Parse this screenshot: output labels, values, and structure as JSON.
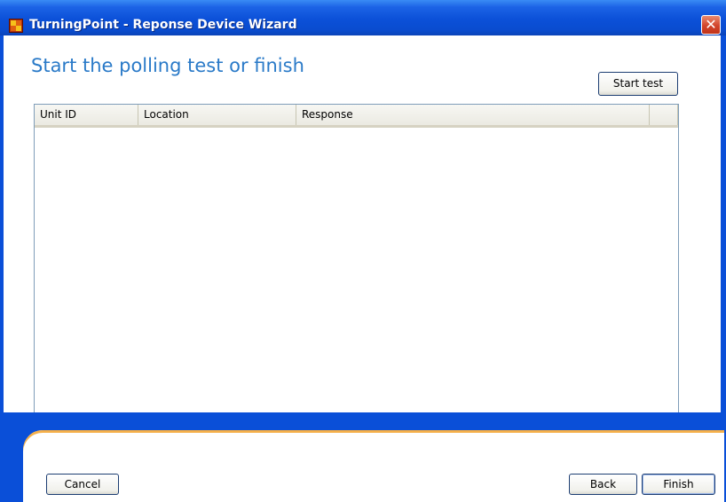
{
  "window": {
    "title": "TurningPoint - Reponse Device Wizard",
    "close_glyph": "✕"
  },
  "page": {
    "heading": "Start the polling test or finish"
  },
  "toolbar": {
    "start_test_label": "Start test"
  },
  "table": {
    "columns": [
      "Unit ID",
      "Location",
      "Response",
      ""
    ],
    "rows": []
  },
  "footer": {
    "cancel_label": "Cancel",
    "back_label": "Back",
    "finish_label": "Finish"
  },
  "colors": {
    "title_bar": "#0a4fd8",
    "heading": "#2a7ac8",
    "accent_orange": "#f5b04a",
    "close": "#d2452c"
  },
  "icons": {
    "app": "turningpoint-app-icon",
    "close": "close-icon"
  }
}
